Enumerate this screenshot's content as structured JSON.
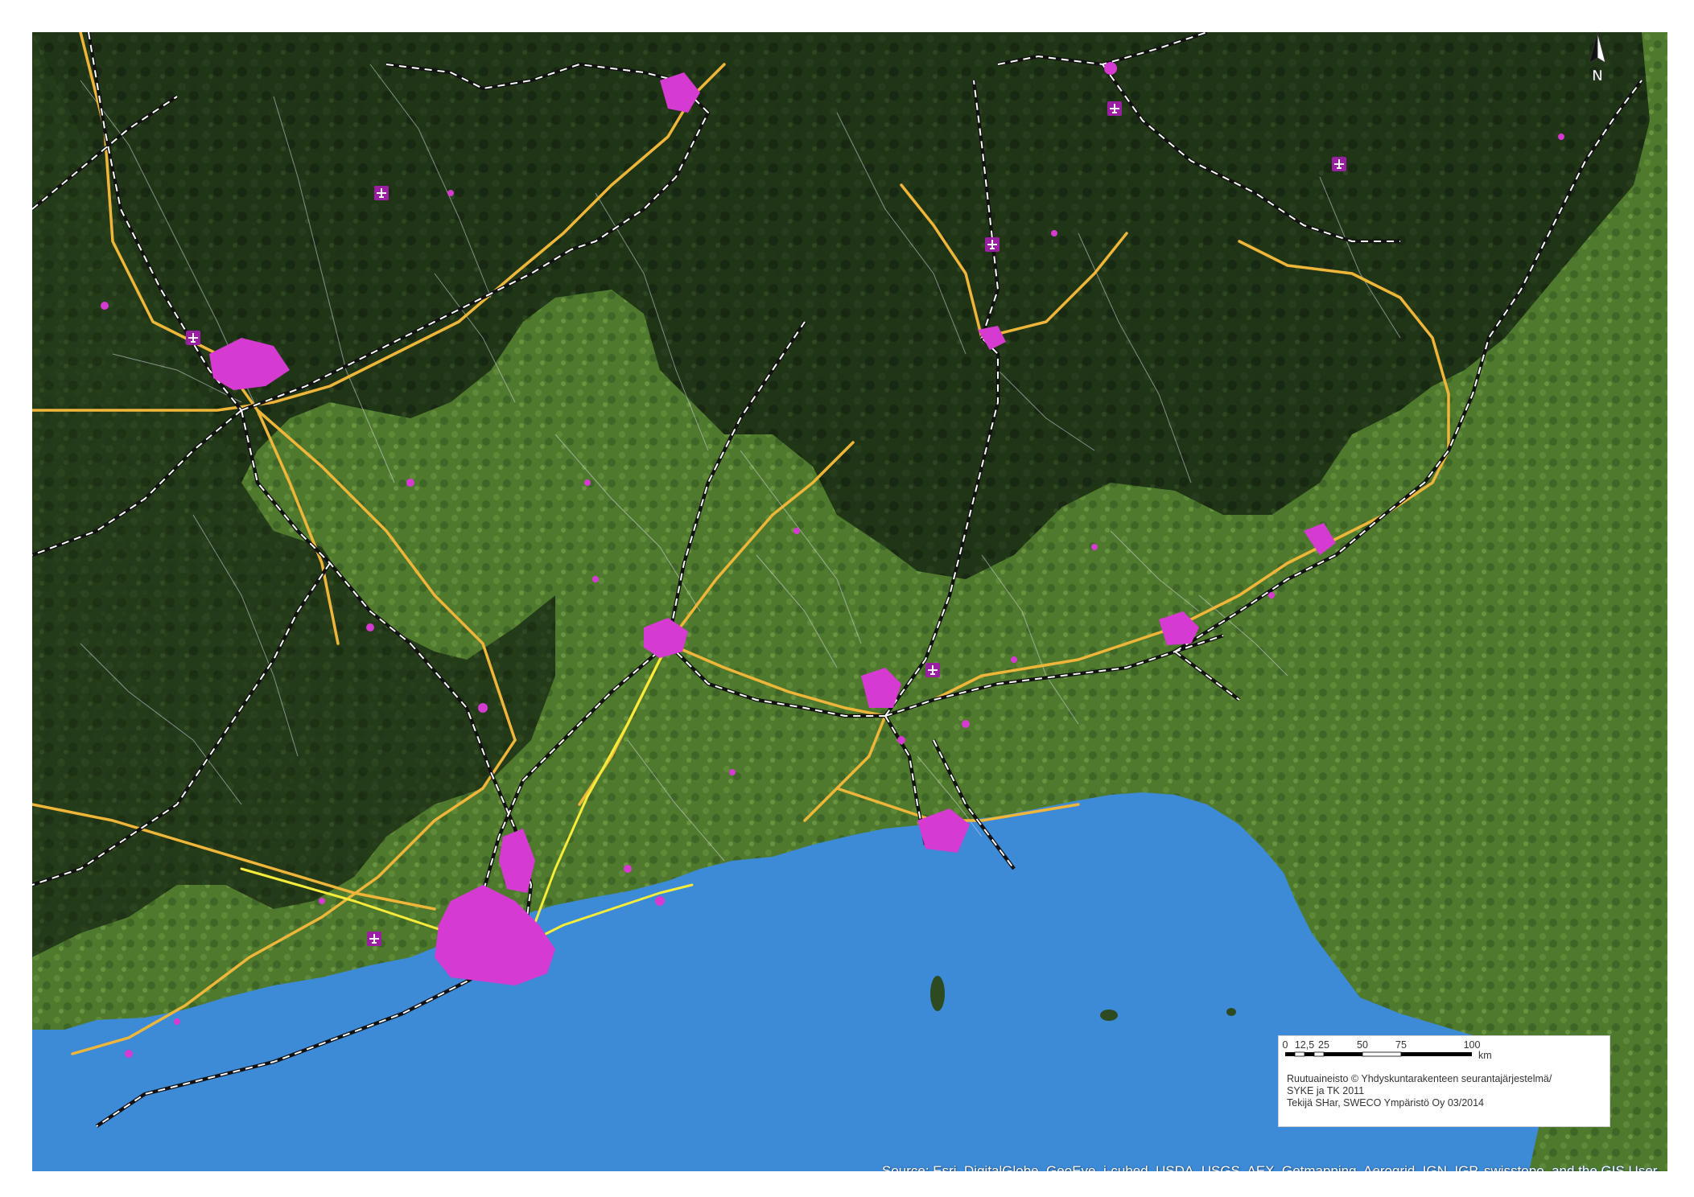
{
  "scale_bar": {
    "ticks": [
      "0",
      "12,5",
      "25",
      "50",
      "75",
      "100"
    ],
    "unit": "km"
  },
  "credits": {
    "line1": "Ruutuaineisto © Yhdyskuntarakenteen seurantajärjestelmä/",
    "line2": "SYKE ja TK 2011",
    "line3": "Tekijä SHar, SWECO Ympäristö Oy 03/2014"
  },
  "source": {
    "text": "Source: Esri, DigitalGlobe, GeoEye, i-cubed, USDA, USGS, AEX, Getmapping, Aerogrid, IGN, IGP, swisstopo, and the GIS User Community"
  },
  "north_arrow": {
    "label": "N"
  },
  "legend_colors": {
    "sea": "#3d8ad6",
    "land_light": "#4f7a2e",
    "land_dark": "#1a2c13",
    "urban": "#d53bd0",
    "main_road": "#f0b63a",
    "motorway": "#f7ec3a",
    "railway": "#ffffff",
    "minor_road": "#d8d8e8"
  },
  "icons": [
    "airport-icon",
    "north-arrow-icon"
  ]
}
